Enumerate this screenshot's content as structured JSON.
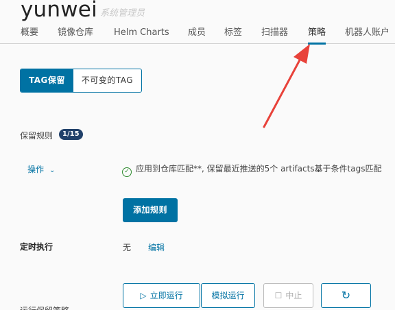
{
  "project": {
    "name": "yunwei",
    "role": "系统管理员"
  },
  "tabs": [
    {
      "label": "概要"
    },
    {
      "label": "镜像仓库"
    },
    {
      "label": "Helm Charts"
    },
    {
      "label": "成员"
    },
    {
      "label": "标签"
    },
    {
      "label": "扫描器"
    },
    {
      "label": "策略",
      "active": true
    },
    {
      "label": "机器人账户"
    }
  ],
  "segment": {
    "tag_retention": "TAG保留",
    "immutable_tag": "不可变的TAG"
  },
  "retention": {
    "rules_label": "保留规则",
    "rules_count": "1/15",
    "action_label": "操作",
    "rule_text": "应用到仓库匹配**, 保留最近推送的5个 artifacts基于条件tags匹配",
    "add_rule_button": "添加规则"
  },
  "schedule": {
    "label": "定时执行",
    "value": "无",
    "edit_link": "编辑"
  },
  "actions": {
    "run_now": "立即运行",
    "dry_run": "模拟运行",
    "abort": "中止"
  },
  "history_label": "运行保留策略",
  "colors": {
    "primary": "#0072a3",
    "badge": "#21416a",
    "annotation": "#e8423a"
  },
  "icons": [
    "check-circle-icon",
    "chevron-down-icon",
    "play-icon",
    "stop-icon",
    "refresh-icon"
  ]
}
